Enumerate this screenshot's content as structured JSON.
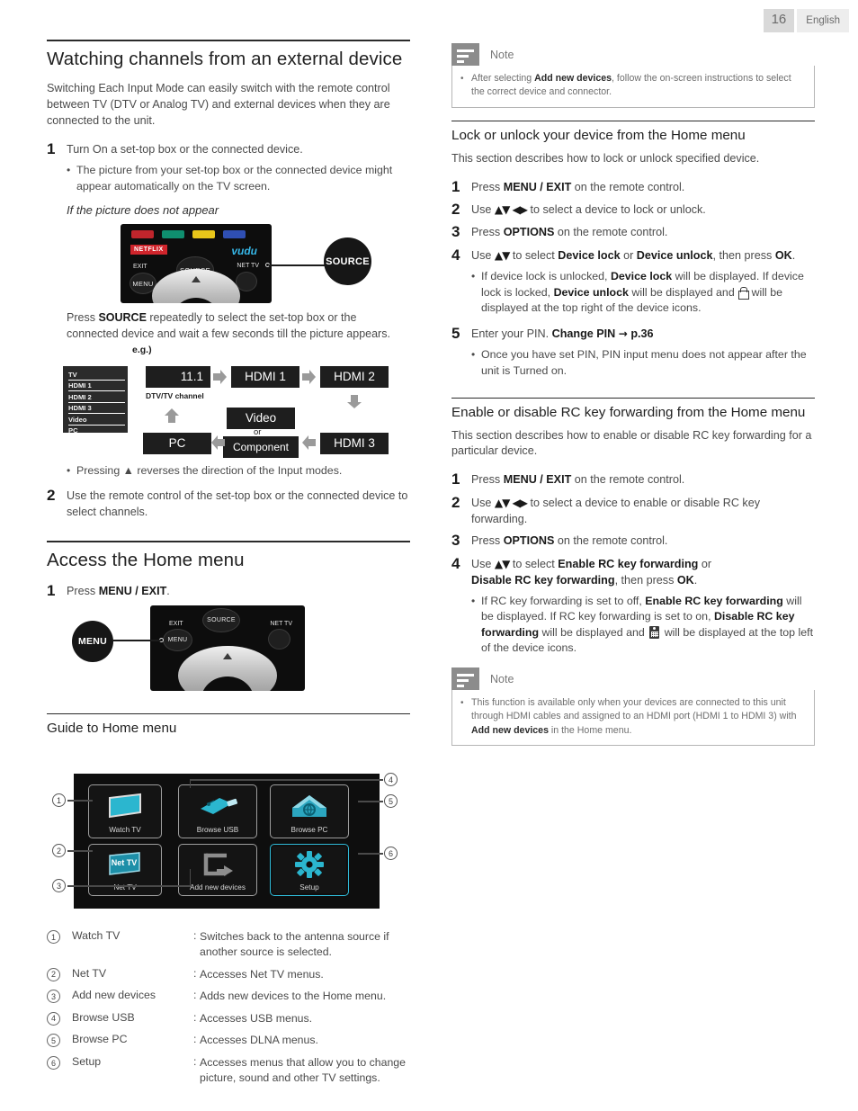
{
  "header": {
    "page_number": "16",
    "language": "English"
  },
  "left": {
    "h1": "Watching channels from an external device",
    "intro": "Switching Each Input Mode can easily switch with the remote control between TV (DTV or Analog TV) and external devices when they are connected to the unit.",
    "step1_num": "1",
    "step1_text": "Turn On a set-top box or the connected device.",
    "step1_bullet": "The picture from your set-top box or the connected device might appear automatically on the TV screen.",
    "italic_head": "If the picture does not appear",
    "remote1": {
      "netflix_label": "NETFLIX",
      "vudu_label": "vudu",
      "source_button": "SOURCE",
      "exit_label": "EXIT",
      "menu_button": "MENU",
      "nettv_label": "NET TV",
      "callout_source": "SOURCE"
    },
    "source_para_pre": "Press ",
    "source_para_bold": "SOURCE",
    "source_para_post": " repeatedly to select the set-top box or the connected device and wait a few seconds till the picture appears.",
    "eg_label": "e.g.)",
    "source_list": [
      "TV",
      "HDMI 1",
      "HDMI 2",
      "HDMI 3",
      "Video",
      "PC"
    ],
    "flow": {
      "channel": "11.1",
      "channel_caption": "DTV/TV channel",
      "hdmi1": "HDMI 1",
      "hdmi2": "HDMI 2",
      "hdmi3": "HDMI 3",
      "video": "Video",
      "or": "or",
      "component": "Component",
      "pc": "PC"
    },
    "flow_bullet": "Pressing ▲ reverses the direction of the Input modes.",
    "step2_num": "2",
    "step2_text": "Use the remote control of the set-top box or the connected device to select channels.",
    "h2_access": "Access the Home menu",
    "access_step_num": "1",
    "access_step_pre": "Press ",
    "access_step_bold": "MENU / EXIT",
    "access_step_post": ".",
    "remote2": {
      "exit_label": "EXIT",
      "menu_button": "MENU",
      "source_button": "SOURCE",
      "nettv_label": "NET TV",
      "callout_menu": "MENU"
    },
    "h3_guide": "Guide to Home menu",
    "tiles": [
      {
        "label": "Watch TV",
        "callout": "1",
        "icon": "tv-icon"
      },
      {
        "label": "Net TV",
        "callout": "2",
        "icon": "nettv-icon"
      },
      {
        "label": "Add new devices",
        "callout": "3",
        "icon": "add-device-icon"
      },
      {
        "label": "Browse USB",
        "callout": "4",
        "icon": "usb-icon"
      },
      {
        "label": "Browse PC",
        "callout": "5",
        "icon": "house-network-icon"
      },
      {
        "label": "Setup",
        "callout": "6",
        "icon": "gear-icon"
      }
    ],
    "legend": [
      {
        "num": "1",
        "name": "Watch TV",
        "desc": "Switches back to the antenna source if another source is selected."
      },
      {
        "num": "2",
        "name": "Net TV",
        "desc": "Accesses Net TV menus."
      },
      {
        "num": "3",
        "name": "Add new devices",
        "desc": "Adds new devices to the Home menu."
      },
      {
        "num": "4",
        "name": "Browse USB",
        "desc": "Accesses USB menus."
      },
      {
        "num": "5",
        "name": "Browse PC",
        "desc": "Accesses DLNA menus."
      },
      {
        "num": "6",
        "name": "Setup",
        "desc": "Accesses menus that allow you to change picture, sound and other TV settings."
      }
    ]
  },
  "right": {
    "note1": {
      "title": "Note",
      "bullet_a": "After selecting ",
      "bullet_b": "Add new devices",
      "bullet_c": ", follow the on-screen instructions to select the correct device and connector."
    },
    "h2_lock": "Lock or unlock your device from the Home menu",
    "lock_intro": "This section describes how to lock or unlock specified device.",
    "lock_steps": [
      {
        "num": "1",
        "pre": "Press ",
        "bold": "MENU / EXIT",
        "post": " on the remote control."
      },
      {
        "num": "2",
        "pre": "Use ",
        "bold": "▲▼ ◀▶",
        "post": " to select a device to lock or unlock."
      },
      {
        "num": "3",
        "pre": "Press ",
        "bold": "OPTIONS",
        "post": " on the remote control."
      }
    ],
    "lock_step4_num": "4",
    "lock_step4_a": "Use ",
    "lock_step4_arrows": "▲▼",
    "lock_step4_b": " to select ",
    "lock_step4_c": "Device lock",
    "lock_step4_d": " or ",
    "lock_step4_e": "Device unlock",
    "lock_step4_f": ", then press ",
    "lock_step4_g": "OK",
    "lock_step4_h": ".",
    "lock_step4_bullet_a": "If device lock is unlocked, ",
    "lock_step4_bullet_b": "Device lock",
    "lock_step4_bullet_c": " will be displayed. If device lock is locked, ",
    "lock_step4_bullet_d": "Device unlock",
    "lock_step4_bullet_e": " will be displayed and ",
    "lock_step4_bullet_f": " will be displayed at the top right of the device icons.",
    "lock_step5_num": "5",
    "lock_step5_a": "Enter your PIN. ",
    "lock_step5_b": "Change PIN",
    "lock_step5_arrow": "→",
    "lock_step5_c": "p.36",
    "lock_step5_bullet": "Once you have set PIN, PIN input menu does not appear after the unit is Turned on.",
    "h2_rc": "Enable or disable RC key forwarding from the Home menu",
    "rc_intro": "This section describes how to enable or disable RC key forwarding for a particular device.",
    "rc_steps": [
      {
        "num": "1",
        "pre": "Press ",
        "bold": "MENU / EXIT",
        "post": " on the remote control."
      },
      {
        "num": "2",
        "pre": "Use ",
        "bold": "▲▼ ◀▶",
        "post": " to select a device to enable or disable RC key forwarding."
      },
      {
        "num": "3",
        "pre": "Press ",
        "bold": "OPTIONS",
        "post": " on the remote control."
      }
    ],
    "rc_step4_num": "4",
    "rc_step4_a": "Use ",
    "rc_step4_arrows": "▲▼",
    "rc_step4_b": " to select ",
    "rc_step4_c": "Enable RC key forwarding",
    "rc_step4_d": " or",
    "rc_step4_e": "Disable RC key forwarding",
    "rc_step4_f": ", then press ",
    "rc_step4_g": "OK",
    "rc_step4_h": ".",
    "rc_step4_bullet_a": "If RC key forwarding is set to off, ",
    "rc_step4_bullet_b": "Enable RC key forwarding",
    "rc_step4_bullet_c": " will be displayed. If RC key forwarding is set to on, ",
    "rc_step4_bullet_d": "Disable RC key forwarding",
    "rc_step4_bullet_e": " will be displayed and ",
    "rc_step4_bullet_f": " will be displayed at the top left of the device icons.",
    "note2": {
      "title": "Note",
      "bullet_a": "This function is available only when your devices are connected to this unit through HDMI cables and assigned to an HDMI port (HDMI 1 to HDMI 3) with ",
      "bullet_b": "Add new devices",
      "bullet_c": " in the Home menu."
    }
  }
}
